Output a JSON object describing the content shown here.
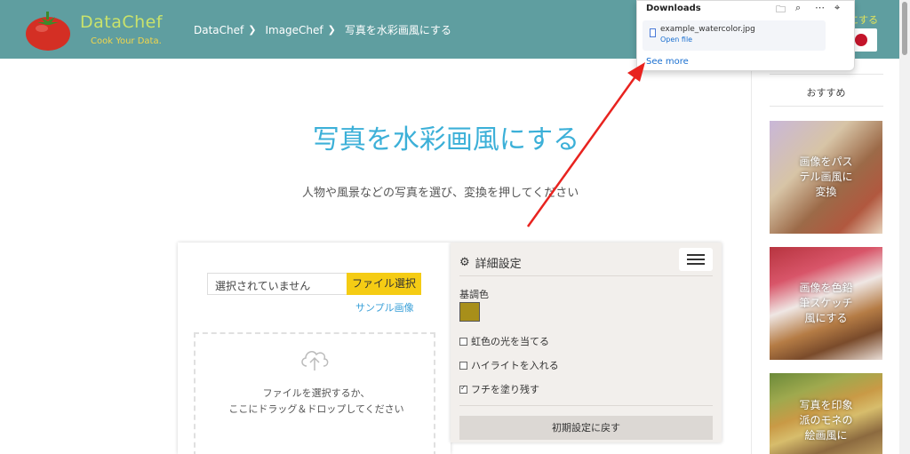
{
  "header": {
    "logo_title": "DataChef",
    "logo_subtitle": "Cook Your Data.",
    "breadcrumbs": [
      "DataChef",
      "ImageChef",
      "写真を水彩画風にする"
    ],
    "right_text": "にする",
    "background_color": "#5f9ea0"
  },
  "main": {
    "title": "写真を水彩画風にする",
    "subtitle": "人物や風景などの写真を選び、変換を押してください",
    "file_input_value": "選択されていません",
    "file_button": "ファイル選択",
    "sample_link": "サンプル画像",
    "drop_line1": "ファイルを選択するか、",
    "drop_line2": "ここにドラッグ＆ドロップしてください"
  },
  "settings": {
    "heading": "詳細設定",
    "base_color_label": "基調色",
    "base_color": "#a88f1a",
    "options": [
      {
        "label": "虹色の光を当てる",
        "checked": false
      },
      {
        "label": "ハイライトを入れる",
        "checked": false
      },
      {
        "label": "フチを塗り残す",
        "checked": true
      }
    ],
    "reset_button": "初期設定に戻す"
  },
  "sidebar": {
    "heading": "おすすめ",
    "items": [
      {
        "caption_line1": "画像をパス",
        "caption_line2": "テル画風に",
        "caption_line3": "変換"
      },
      {
        "caption_line1": "画像を色鉛",
        "caption_line2": "筆スケッチ",
        "caption_line3": "風にする"
      },
      {
        "caption_line1": "写真を印象",
        "caption_line2": "派のモネの",
        "caption_line3": "絵画風に"
      }
    ]
  },
  "downloads": {
    "title": "Downloads",
    "icons": [
      "folder-icon",
      "search-icon",
      "more-icon",
      "pin-icon"
    ],
    "file_name": "example_watercolor.jpg",
    "open_file": "Open file",
    "see_more": "See more"
  },
  "annotation": {
    "arrow_color": "#e8231f"
  }
}
